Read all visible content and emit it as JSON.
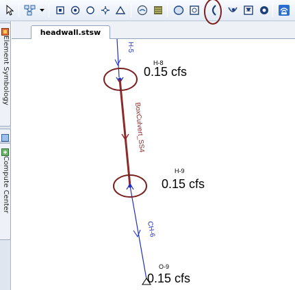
{
  "document": {
    "tab_title": "headwall.stsw"
  },
  "panels": {
    "element_symbology": "Element Symbology",
    "compute_center": "Compute Center"
  },
  "toolbar": {
    "icons": [
      "select-arrow-icon",
      "layout-tool-icon",
      "dropdown-arrow-icon",
      "catch-basin-icon",
      "manhole-icon",
      "junction-icon",
      "transition-icon",
      "outfall-icon",
      "pond-icon",
      "catchment-icon",
      "pond-outlet-icon",
      "cross-section-icon",
      "headwall-icon",
      "channel-icon",
      "spillway-icon",
      "pipe-icon",
      "wireless-icon"
    ],
    "highlighted_tool": "headwall-icon"
  },
  "network": {
    "nodes": {
      "h8": {
        "label": "H-8",
        "flow": "0.15 cfs"
      },
      "h9": {
        "label": "H-9",
        "flow": "0.15 cfs"
      },
      "o9": {
        "label": "O-9",
        "flow": "0.15 cfs"
      }
    },
    "links": {
      "h5": {
        "label": "H-5",
        "color": "#1f2fbf"
      },
      "culvert": {
        "label": "BoxCulvert_SS4",
        "color": "#8a2a2a"
      },
      "ch6": {
        "label": "CH-6",
        "color": "#1f2fbf"
      }
    },
    "annotation_color": "#7a1f1f"
  }
}
